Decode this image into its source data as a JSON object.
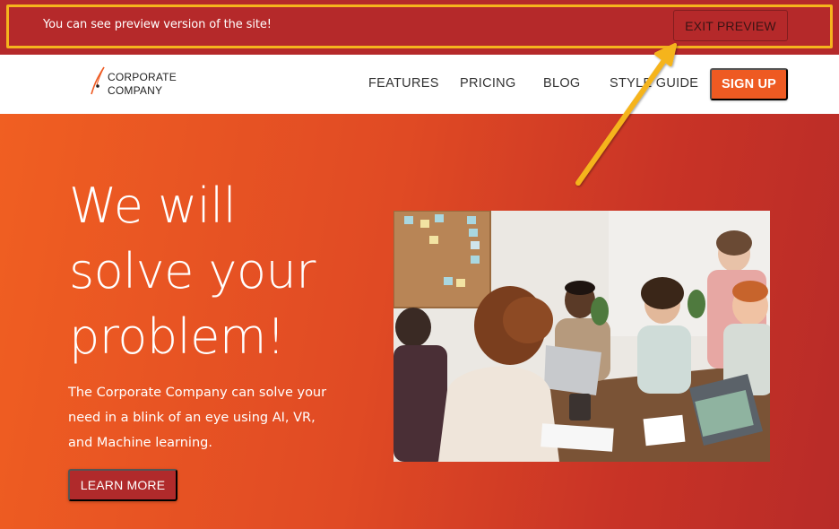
{
  "preview_bar": {
    "message": "You can see preview version of the site!",
    "exit_label": "EXIT PREVIEW"
  },
  "navbar": {
    "logo_line1": "CORPORATE",
    "logo_line2": "COMPANY",
    "links": [
      "FEATURES",
      "PRICING",
      "BLOG",
      "STYLE GUIDE"
    ],
    "signup_label": "SIGN UP"
  },
  "hero": {
    "headline_line1": "We will",
    "headline_line2": "solve your",
    "headline_line3": "problem!",
    "subtext": "The Corporate Company can solve your need in a blink of an eye using AI, VR, and Machine learning.",
    "cta_label": "LEARN MORE"
  },
  "colors": {
    "preview_bar": "#b5292a",
    "highlight": "#f5b41d",
    "accent": "#ee5a22",
    "hero_start": "#f05f22",
    "hero_end": "#b82b28"
  },
  "icons": {
    "logo": "quill-logo-icon",
    "annotation": "arrow-icon"
  }
}
